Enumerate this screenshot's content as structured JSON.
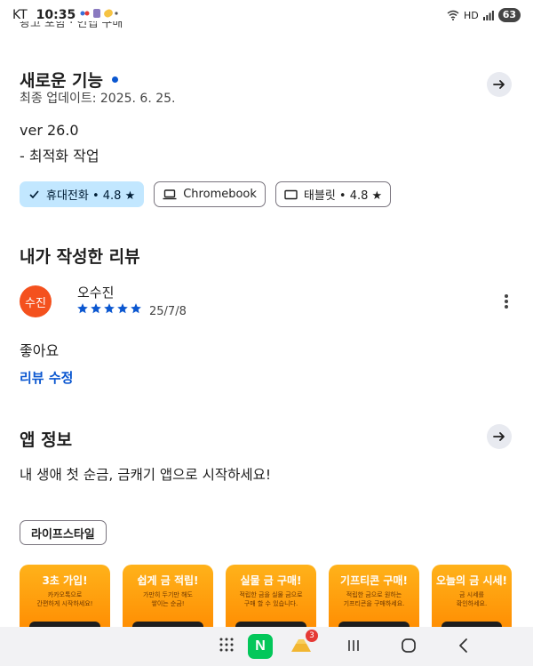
{
  "status_bar": {
    "carrier": "KT",
    "time": "10:35",
    "battery": "63"
  },
  "top_cut_text": "광고 포함 · 인앱 구매",
  "whats_new": {
    "title": "새로운 기능",
    "updated": "최종 업데이트: 2025. 6. 25.",
    "version": "ver 26.0",
    "note": "- 최적화 작업"
  },
  "devices": [
    {
      "label": "휴대전화 • 4.8 ★",
      "icon": "check-icon",
      "selected": true
    },
    {
      "label": "Chromebook",
      "icon": "laptop-icon",
      "selected": false
    },
    {
      "label": "태블릿 • 4.8 ★",
      "icon": "tablet-icon",
      "selected": false
    }
  ],
  "my_review": {
    "title": "내가 작성한 리뷰",
    "avatar_text": "수진",
    "reviewer": "오수진",
    "rating": 5,
    "date": "25/7/8",
    "text": "좋아요",
    "edit_label": "리뷰 수정"
  },
  "app_info": {
    "title": "앱 정보",
    "description": "내 생애 첫 순금, 금캐기 앱으로 시작하세요!",
    "category": "라이프스타일"
  },
  "screenshots": [
    {
      "heading": "3초 가입!",
      "sub1": "카카오톡으로",
      "sub2": "간편하게 시작하세요!"
    },
    {
      "heading": "쉽게 금 적립!",
      "sub1": "가만히 두기만 해도",
      "sub2": "쌓이는 순금!"
    },
    {
      "heading": "실물 금 구매!",
      "sub1": "적립한 금을 실물 금으로",
      "sub2": "구매 할 수 있습니다."
    },
    {
      "heading": "기프티콘 구매!",
      "sub1": "적립한 금으로 원하는",
      "sub2": "기프티콘을 구매하세요."
    },
    {
      "heading": "오늘의 금 시세!",
      "sub1": "금 시세를",
      "sub2": "확인하세요."
    }
  ],
  "nav": {
    "naver_label": "N",
    "gold_badge": "3"
  },
  "colors": {
    "accent": "#0b57d0",
    "chip_selected": "#c2e7ff",
    "avatar": "#f4511e",
    "screenshot_orange": "#ff9800",
    "naver_green": "#03c75a"
  }
}
